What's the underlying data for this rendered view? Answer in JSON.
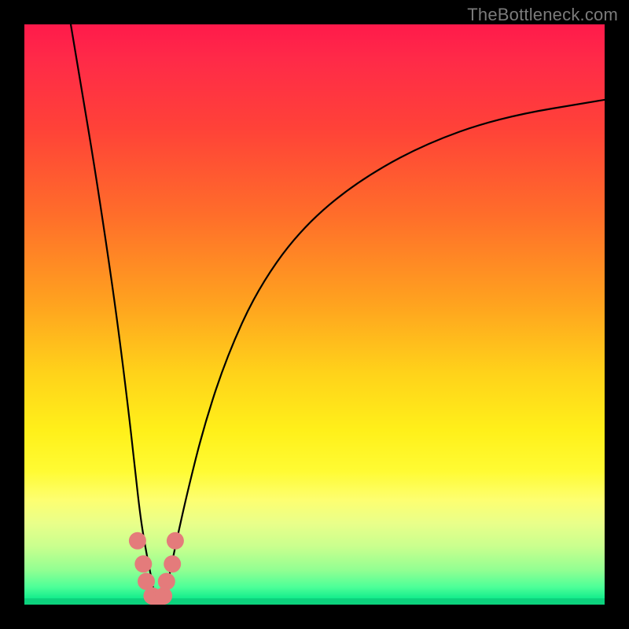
{
  "watermark": "TheBottleneck.com",
  "colors": {
    "frame": "#000000",
    "curve": "#000000",
    "marker_fill": "#e47b7b",
    "marker_stroke": "#c85a5a"
  },
  "chart_data": {
    "type": "line",
    "title": "",
    "xlabel": "",
    "ylabel": "",
    "xlim": [
      0,
      100
    ],
    "ylim": [
      0,
      100
    ],
    "note": "Axes are unlabeled; values are approximate readings from the plotted curve (x left→right, y bottom→top, both 0–100).",
    "series": [
      {
        "name": "left-branch",
        "x": [
          8,
          10,
          12,
          14,
          16,
          18,
          19,
          20,
          21,
          22,
          22.5
        ],
        "y": [
          100,
          88,
          76,
          63,
          49,
          33,
          24,
          15,
          9,
          4,
          1
        ]
      },
      {
        "name": "right-branch",
        "x": [
          24,
          25,
          26,
          28,
          31,
          35,
          40,
          47,
          56,
          68,
          82,
          100
        ],
        "y": [
          1,
          5,
          10,
          19,
          31,
          43,
          54,
          64,
          72,
          79,
          84,
          87
        ]
      }
    ],
    "markers": {
      "name": "highlighted-points",
      "style": "round",
      "x": [
        19.5,
        20.5,
        21,
        22,
        23,
        24,
        24.5,
        25.5,
        26
      ],
      "y": [
        11,
        7,
        4,
        1.5,
        0.8,
        1.5,
        4,
        7,
        11
      ]
    },
    "background_gradient": {
      "direction": "top-to-bottom",
      "stops": [
        {
          "pos": 0.0,
          "color": "#ff1a4b"
        },
        {
          "pos": 0.33,
          "color": "#ff6e2a"
        },
        {
          "pos": 0.6,
          "color": "#ffd21a"
        },
        {
          "pos": 0.82,
          "color": "#fdff71"
        },
        {
          "pos": 0.94,
          "color": "#93ff92"
        },
        {
          "pos": 1.0,
          "color": "#0cd27d"
        }
      ]
    }
  }
}
